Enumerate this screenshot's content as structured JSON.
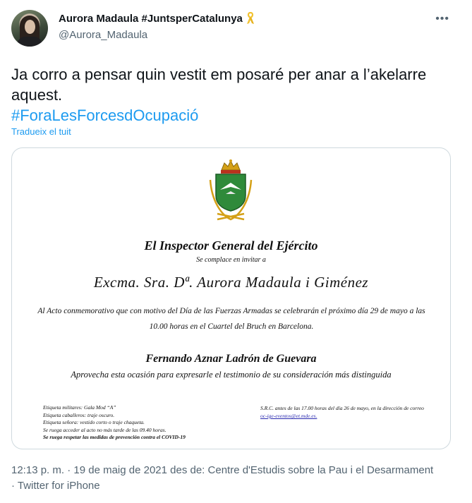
{
  "author": {
    "display_name": "Aurora Madaula #JuntsperCatalunya",
    "handle": "@Aurora_Madaula",
    "badge_icon": "yellow-ribbon-icon"
  },
  "more_icon": "more-options-icon",
  "tweet": {
    "text_line": "Ja corro a pensar quin vestit em posaré per anar a l’akelarre aquest.",
    "hashtag": "#ForaLesForcesdOcupació",
    "translate_label": "Tradueix el tuit"
  },
  "invitation": {
    "title": "El Inspector General del Ejército",
    "subtitle": "Se complace en invitar a",
    "guest": "Excma. Sra. Dª. Aurora Madaula i Giménez",
    "body": "Al Acto conmemorativo que con motivo del Día de las Fuerzas Armadas se celebrarán el próximo día 29 de mayo a las 10.00 horas en el Cuartel del Bruch en Barcelona.",
    "signer": "Fernando Aznar Ladrón de Guevara",
    "closing": "Aprovecha esta ocasión para expresarle el testimonio de su consideración más distinguida",
    "dress_military": "Etiqueta militares: Gala Mod “A”",
    "dress_men": "Etiqueta caballeros: traje oscuro.",
    "dress_women": "Etiqueta señora: vestido corto o traje chaqueta.",
    "arrival": "Se ruega acceder al acto no más tarde de las 09.40 horas.",
    "covid": "Se ruega respetar las medidas de prevención contra el COVID-19",
    "rsvp": "S.R.C. antes de las 17.00 horas del día 26 de mayo, en la dirección de correo",
    "rsvp_email": "oc-ige-eventos@et.mde.es."
  },
  "meta": {
    "timestamp": "12:13 p. m. · 19 de maig de 2021 des de: Centre d'Estudis sobre la Pau i el Desarmament · Twitter for iPhone"
  }
}
